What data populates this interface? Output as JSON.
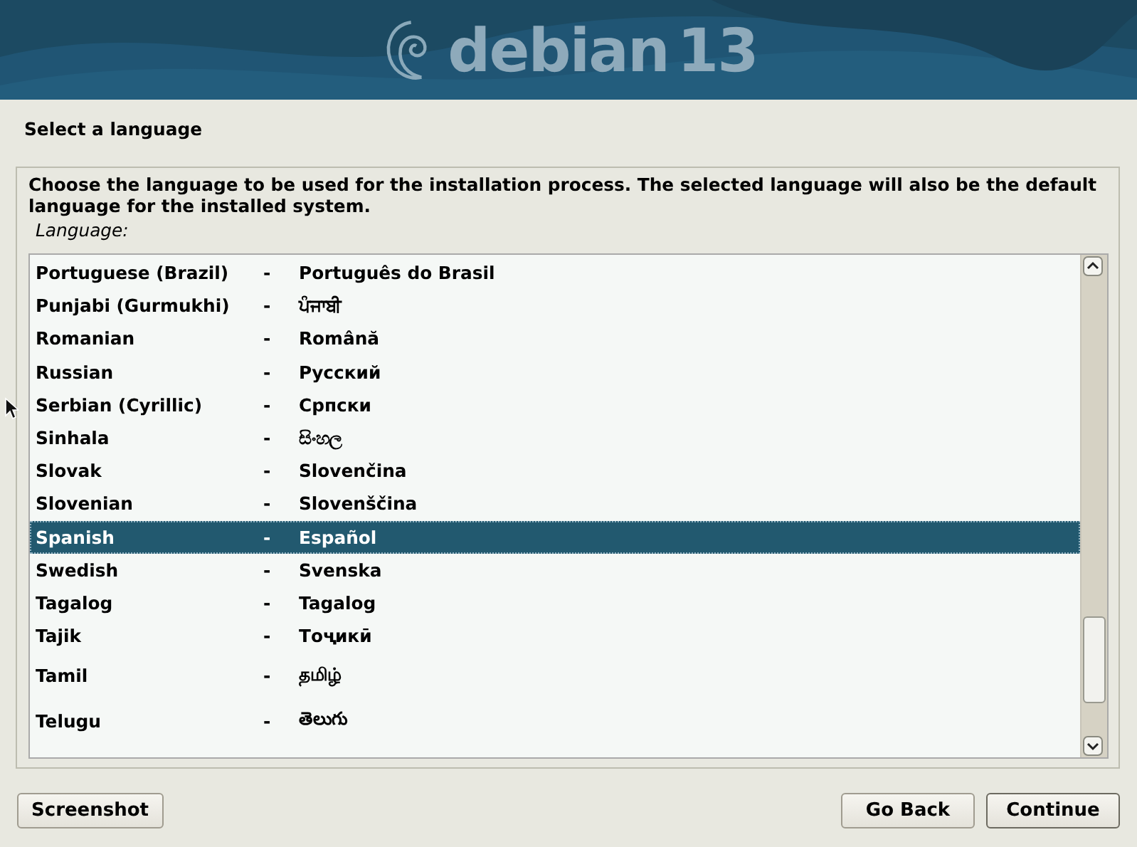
{
  "banner": {
    "logo_word": "debian",
    "logo_version": "13"
  },
  "title": "Select a language",
  "instructions": "Choose the language to be used for the installation process. The selected language will also be the default language for the installed system.",
  "list_label": "Language:",
  "languages": [
    {
      "name": "Portuguese (Brazil)",
      "separator": "-",
      "native": "Português do Brasil",
      "selected": false
    },
    {
      "name": "Punjabi (Gurmukhi)",
      "separator": "-",
      "native": "ਪੰਜਾਬੀ",
      "selected": false
    },
    {
      "name": "Romanian",
      "separator": "-",
      "native": "Română",
      "selected": false
    },
    {
      "name": "Russian",
      "separator": "-",
      "native": "Русский",
      "selected": false
    },
    {
      "name": "Serbian (Cyrillic)",
      "separator": "-",
      "native": "Српски",
      "selected": false
    },
    {
      "name": "Sinhala",
      "separator": "-",
      "native": "සිංහල",
      "selected": false
    },
    {
      "name": "Slovak",
      "separator": "-",
      "native": "Slovenčina",
      "selected": false
    },
    {
      "name": "Slovenian",
      "separator": "-",
      "native": "Slovenščina",
      "selected": false
    },
    {
      "name": "Spanish",
      "separator": "-",
      "native": "Español",
      "selected": true
    },
    {
      "name": "Swedish",
      "separator": "-",
      "native": "Svenska",
      "selected": false
    },
    {
      "name": "Tagalog",
      "separator": "-",
      "native": "Tagalog",
      "selected": false
    },
    {
      "name": "Tajik",
      "separator": "-",
      "native": "Тоҷикӣ",
      "selected": false
    },
    {
      "name": "Tamil",
      "separator": "-",
      "native": "தமிழ்",
      "selected": false
    },
    {
      "name": "Telugu",
      "separator": "-",
      "native": "తెలుగు",
      "selected": false
    }
  ],
  "buttons": [
    "Screenshot",
    "Go Back",
    "Continue"
  ]
}
